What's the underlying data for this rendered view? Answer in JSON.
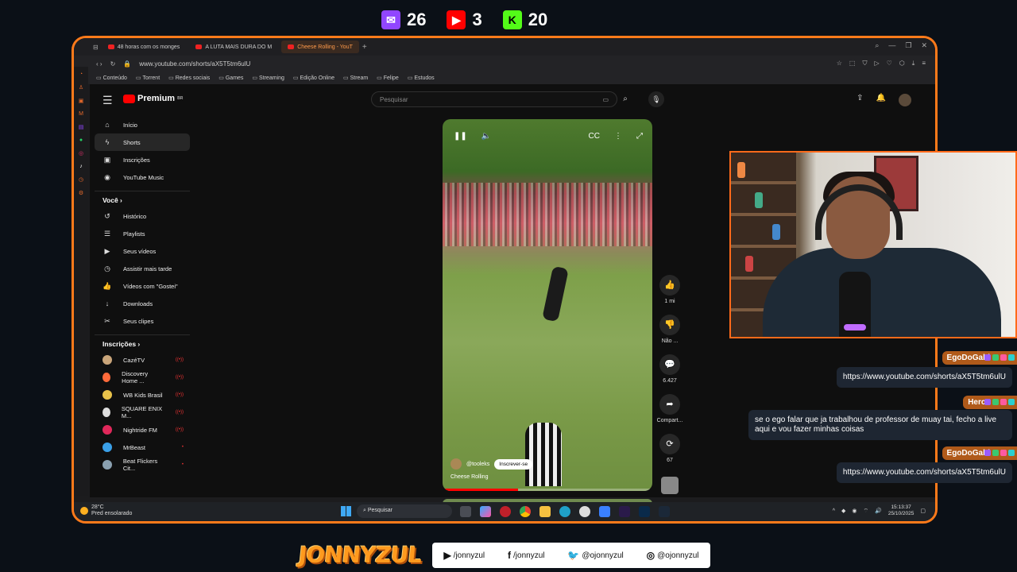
{
  "stats": [
    {
      "platform_icon": "twitch-icon",
      "value": "26",
      "color": "#9146ff"
    },
    {
      "platform_icon": "youtube-icon",
      "value": "3",
      "color": "#ff0000"
    },
    {
      "platform_icon": "kick-icon",
      "value": "20",
      "color": "#53fc18"
    }
  ],
  "browser": {
    "tabs": [
      {
        "label": "48 horas com os monges"
      },
      {
        "label": "A LUTA MAIS DURA DO M"
      },
      {
        "label": "Cheese Rolling - YouT"
      }
    ],
    "url": "www.youtube.com/shorts/aX5T5tm6ulU",
    "bookmarks": [
      "Conteúdo",
      "Torrent",
      "Redes sociais",
      "Games",
      "Streaming",
      "Edição Online",
      "Stream",
      "Felipe",
      "Estudos"
    ]
  },
  "youtube": {
    "logo": "Premium",
    "logo_region": "BR",
    "search_placeholder": "Pesquisar",
    "nav": [
      {
        "label": "Início",
        "icon": "home-icon",
        "glyph": "⌂"
      },
      {
        "label": "Shorts",
        "icon": "shorts-icon",
        "glyph": "ϟ"
      },
      {
        "label": "Inscrições",
        "icon": "subscriptions-icon",
        "glyph": "▣"
      },
      {
        "label": "YouTube Music",
        "icon": "music-icon",
        "glyph": "◉"
      }
    ],
    "you_header": "Você",
    "you_items": [
      {
        "label": "Histórico",
        "icon": "history-icon",
        "glyph": "↺"
      },
      {
        "label": "Playlists",
        "icon": "playlists-icon",
        "glyph": "☰"
      },
      {
        "label": "Seus vídeos",
        "icon": "your-videos-icon",
        "glyph": "▶"
      },
      {
        "label": "Assistir mais tarde",
        "icon": "watch-later-icon",
        "glyph": "◷"
      },
      {
        "label": "Vídeos com \"Gostei\"",
        "icon": "like-icon",
        "glyph": "👍"
      },
      {
        "label": "Downloads",
        "icon": "download-icon",
        "glyph": "↓"
      },
      {
        "label": "Seus clipes",
        "icon": "clips-icon",
        "glyph": "✂"
      }
    ],
    "subs_header": "Inscrições",
    "subs": [
      {
        "label": "CazéTV",
        "color": "#c9a57a"
      },
      {
        "label": "Discovery Home ...",
        "color": "#ff6a3a"
      },
      {
        "label": "WB Kids Brasil",
        "color": "#e8c24a"
      },
      {
        "label": "SQUARE ENIX M...",
        "color": "#dddddd"
      },
      {
        "label": "Nightride FM",
        "color": "#e0285a"
      },
      {
        "label": "MrBeast",
        "color": "#3aa0e8"
      },
      {
        "label": "Beat Flickers Cit...",
        "color": "#8aa0b0"
      }
    ],
    "short": {
      "channel": "@tooleks",
      "subscribe": "Inscrever-se",
      "title": "Cheese Rolling",
      "progress": 0.36
    },
    "actions": [
      {
        "icon": "like-icon",
        "glyph": "👍",
        "label": "1 mi"
      },
      {
        "icon": "dislike-icon",
        "glyph": "👎",
        "label": "Não ..."
      },
      {
        "icon": "comment-icon",
        "glyph": "💬",
        "label": "6.427"
      },
      {
        "icon": "share-icon",
        "glyph": "➦",
        "label": "Compart..."
      },
      {
        "icon": "remix-icon",
        "glyph": "⟳",
        "label": "67"
      }
    ]
  },
  "taskbar": {
    "temp": "28°C",
    "weather": "Pred ensolarado",
    "search": "Pesquisar",
    "time": "15:13:37",
    "date": "25/10/2025"
  },
  "chat": [
    {
      "user": "EgoDoGabi",
      "message": "https://www.youtube.com/shorts/aX5T5tm6ulU"
    },
    {
      "user": "Herc9",
      "message": "se o ego falar que ja trabalhou de professor de muay tai, fecho a live aqui e vou fazer minhas coisas"
    },
    {
      "user": "EgoDoGabi",
      "message": "https://www.youtube.com/shorts/aX5T5tm6ulU"
    }
  ],
  "brand": "JONNYZUL",
  "socials": [
    {
      "icon": "youtube-icon",
      "glyph": "▶",
      "label": "/jonnyzul"
    },
    {
      "icon": "facebook-icon",
      "glyph": "f",
      "label": "/jonnyzul"
    },
    {
      "icon": "twitter-icon",
      "glyph": "🐦",
      "label": "@ojonnyzul"
    },
    {
      "icon": "instagram-icon",
      "glyph": "◎",
      "label": "@ojonnyzul"
    }
  ]
}
